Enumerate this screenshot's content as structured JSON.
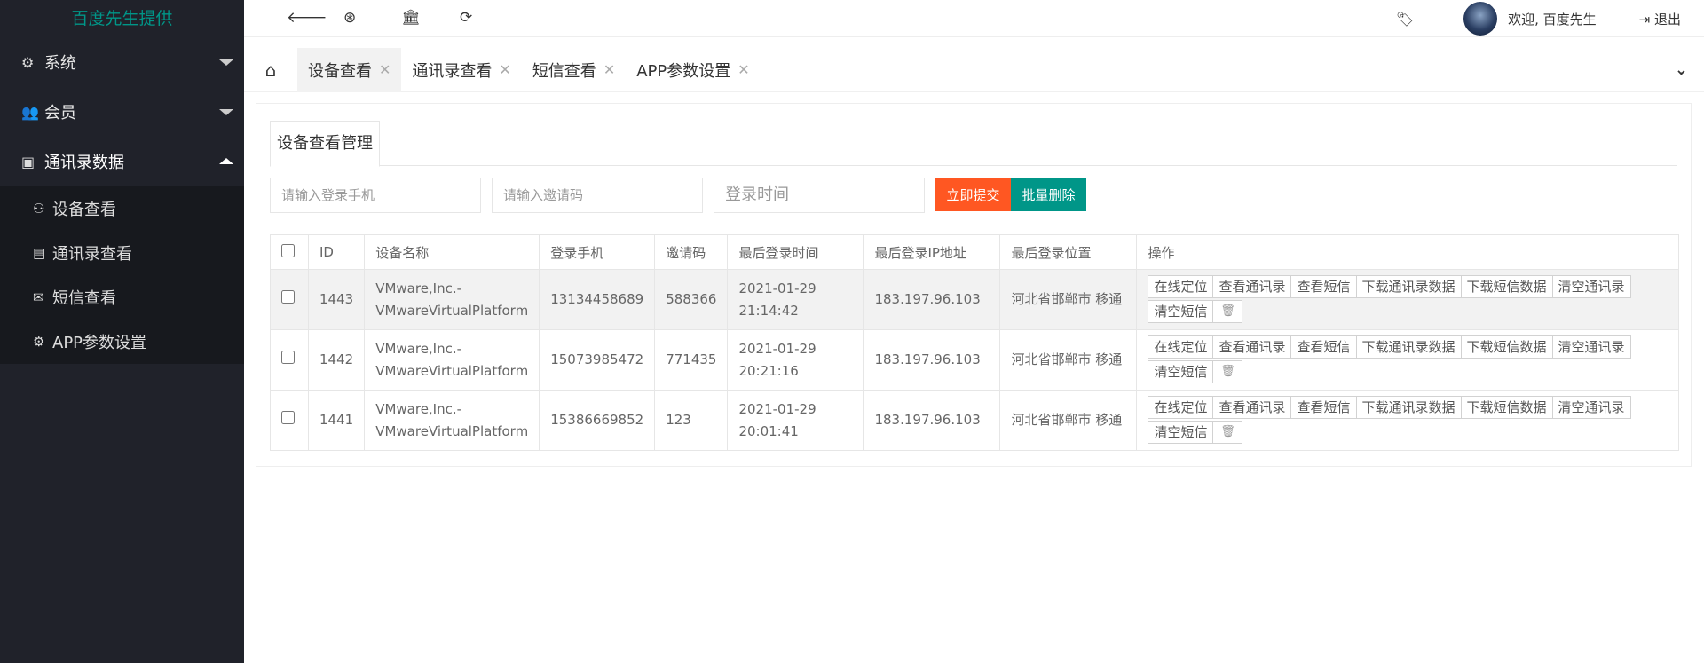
{
  "sidebar": {
    "logo": "百度先生提供",
    "menus": [
      {
        "label": "系统",
        "icon": "gear-icon"
      },
      {
        "label": "会员",
        "icon": "users-icon"
      },
      {
        "label": "通讯录数据",
        "icon": "id-card-icon"
      }
    ],
    "submenu": [
      {
        "label": "设备查看",
        "icon": "user-icon"
      },
      {
        "label": "通讯录查看",
        "icon": "building-icon"
      },
      {
        "label": "短信查看",
        "icon": "envelope-icon"
      },
      {
        "label": "APP参数设置",
        "icon": "gear-icon"
      }
    ]
  },
  "header": {
    "welcome": "欢迎, 百度先生",
    "logout": "退出"
  },
  "tabs": [
    {
      "label": "设备查看"
    },
    {
      "label": "通讯录查看"
    },
    {
      "label": "短信查看"
    },
    {
      "label": "APP参数设置"
    }
  ],
  "card": {
    "title": "设备查看管理",
    "phone_placeholder": "请输入登录手机",
    "invite_placeholder": "请输入邀请码",
    "time_placeholder": "登录时间",
    "submit_label": "立即提交",
    "batch_delete_label": "批量删除"
  },
  "table": {
    "headers": [
      "ID",
      "设备名称",
      "登录手机",
      "邀请码",
      "最后登录时间",
      "最后登录IP地址",
      "最后登录位置",
      "操作"
    ],
    "ops": [
      "在线定位",
      "查看通讯录",
      "查看短信",
      "下载通讯录数据",
      "下载短信数据",
      "清空通讯录",
      "清空短信"
    ],
    "rows": [
      {
        "id": "1443",
        "device_line1": "VMware,Inc.-",
        "device_line2": "VMwareVirtualPlatform",
        "phone": "13134458689",
        "invite": "588366",
        "date": "2021-01-29",
        "time": "21:14:42",
        "ip": "183.197.96.103",
        "location": "河北省邯郸市 移通"
      },
      {
        "id": "1442",
        "device_line1": "VMware,Inc.-",
        "device_line2": "VMwareVirtualPlatform",
        "phone": "15073985472",
        "invite": "771435",
        "date": "2021-01-29",
        "time": "20:21:16",
        "ip": "183.197.96.103",
        "location": "河北省邯郸市 移通"
      },
      {
        "id": "1441",
        "device_line1": "VMware,Inc.-",
        "device_line2": "VMwareVirtualPlatform",
        "phone": "15386669852",
        "invite": "123",
        "date": "2021-01-29",
        "time": "20:01:41",
        "ip": "183.197.96.103",
        "location": "河北省邯郸市 移通"
      }
    ]
  },
  "colors": {
    "sidebar_bg": "#20222a",
    "logo": "#009688",
    "submit": "#ff5722",
    "batch_delete": "#009688"
  }
}
